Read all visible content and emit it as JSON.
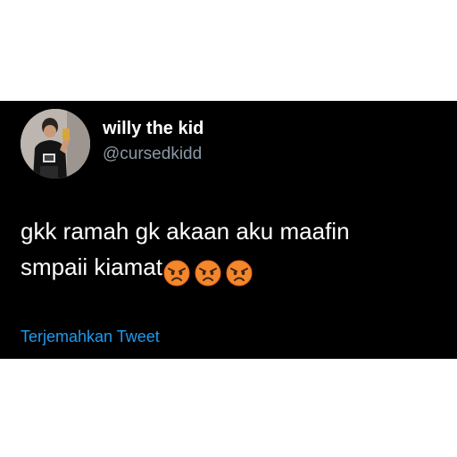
{
  "tweet": {
    "author": {
      "display_name": "willy the kid",
      "handle": "@cursedkidd",
      "avatar_icon": "profile-photo"
    },
    "text_line_1": "gkk ramah gk akaan aku maafin",
    "text_line_2": "smpaii kiamat",
    "emojis": [
      "angry-face-icon",
      "angry-face-icon",
      "angry-face-icon"
    ],
    "translate_label": "Terjemahkan Tweet"
  },
  "colors": {
    "card_background": "#000000",
    "page_background": "#ffffff",
    "text": "#ffffff",
    "handle": "#8b98a5",
    "link": "#1d9bf0",
    "emoji_face": "#f4872a"
  }
}
